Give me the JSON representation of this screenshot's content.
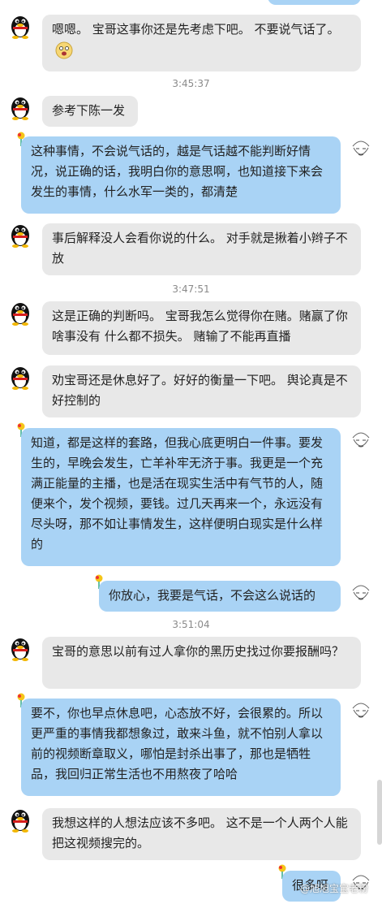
{
  "messages": [
    {
      "text": "嗯嗯。 宝哥这事你还是先考虑下吧。 不要说气话了。"
    },
    {
      "time": "3:45:37"
    },
    {
      "text": "参考下陈一发"
    },
    {
      "text": "这种事情，不会说气话的，越是气话越不能判断好情况，说正确的话，我明白你的意思啊，也知道接下来会发生的事情，什么水军一类的，都清楚"
    },
    {
      "text": "事后解释没人会看你说的什么。 对手就是揪着小辫子不放"
    },
    {
      "time": "3:47:51"
    },
    {
      "text": "这是正确的判断吗。 宝哥我怎么觉得你在赌。赌赢了你啥事没有 什么都不损失。 赌输了不能再直播"
    },
    {
      "text": "劝宝哥还是休息好了。好好的衡量一下吧。 舆论真是不好控制的"
    },
    {
      "text": "知道，都是这样的套路，但我心底更明白一件事。要发生的，早晚会发生，亡羊补牢无济于事。我更是一个充满正能量的主播，也是活在现实生活中有气节的人，随便来个，发个视频，要钱。过几天再来一个，永远没有尽头呀，那不如让事情发生，这样便明白现实是什么样的"
    },
    {
      "text": "你放心，我要是气话，不会这么说话的"
    },
    {
      "time": "3:51:04"
    },
    {
      "text": "宝哥的意思以前有过人拿你的黑历史找过你要报酬吗？"
    },
    {
      "text": "要不，你也早点休息吧，心态放不好，会很累的。所以更严重的事情我都想象过，敢来斗鱼，就不怕别人拿以前的视频断章取义，哪怕是封杀出事了，那也是牺牲品，我回归正常生活也不用熬夜了哈哈"
    },
    {
      "text": "我想这样的人想法应该不多吧。 这不是一个人两个人能把这视频搜完的。"
    },
    {
      "text": "很多呀"
    }
  ],
  "watermark": "@旭旭宝宝老粉",
  "colors": {
    "incoming": "#e8e8e8",
    "outgoing": "#a9d3f5",
    "background": "#ffffff"
  }
}
